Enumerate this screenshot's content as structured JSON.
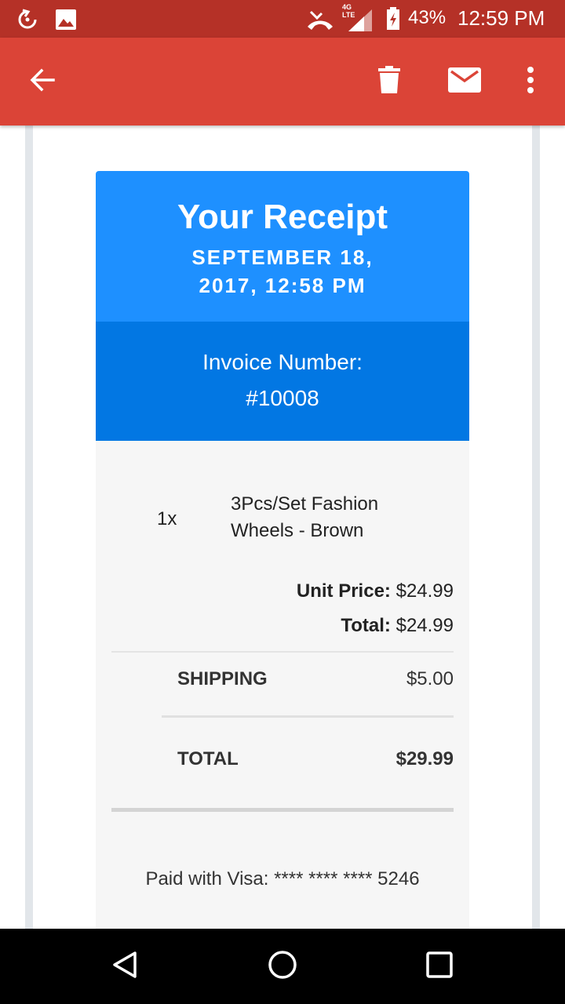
{
  "status_bar": {
    "network_label": "4G LTE",
    "battery_percent": "43%",
    "time": "12:59 PM"
  },
  "toolbar": {
    "icons": [
      "back-arrow-icon",
      "delete-icon",
      "mail-icon",
      "more-vert-icon"
    ]
  },
  "receipt": {
    "title": "Your Receipt",
    "date": "SEPTEMBER 18, 2017, 12:58 PM",
    "invoice_label": "Invoice Number:",
    "invoice_number": "#10008",
    "item": {
      "quantity": "1x",
      "name": "3Pcs/Set Fashion Wheels - Brown",
      "unit_price_label": "Unit Price:",
      "unit_price": "$24.99",
      "total_label": "Total:",
      "total": "$24.99"
    },
    "shipping_label": "SHIPPING",
    "shipping_value": "$5.00",
    "total_label": "TOTAL",
    "total_value": "$29.99",
    "payment": "Paid with Visa: **** **** **** 5246"
  },
  "colors": {
    "status_bar": "#b53127",
    "app_bar": "#db4437",
    "receipt_header": "#1e90ff",
    "invoice_band": "#0277e3",
    "receipt_body": "#f6f6f6"
  }
}
